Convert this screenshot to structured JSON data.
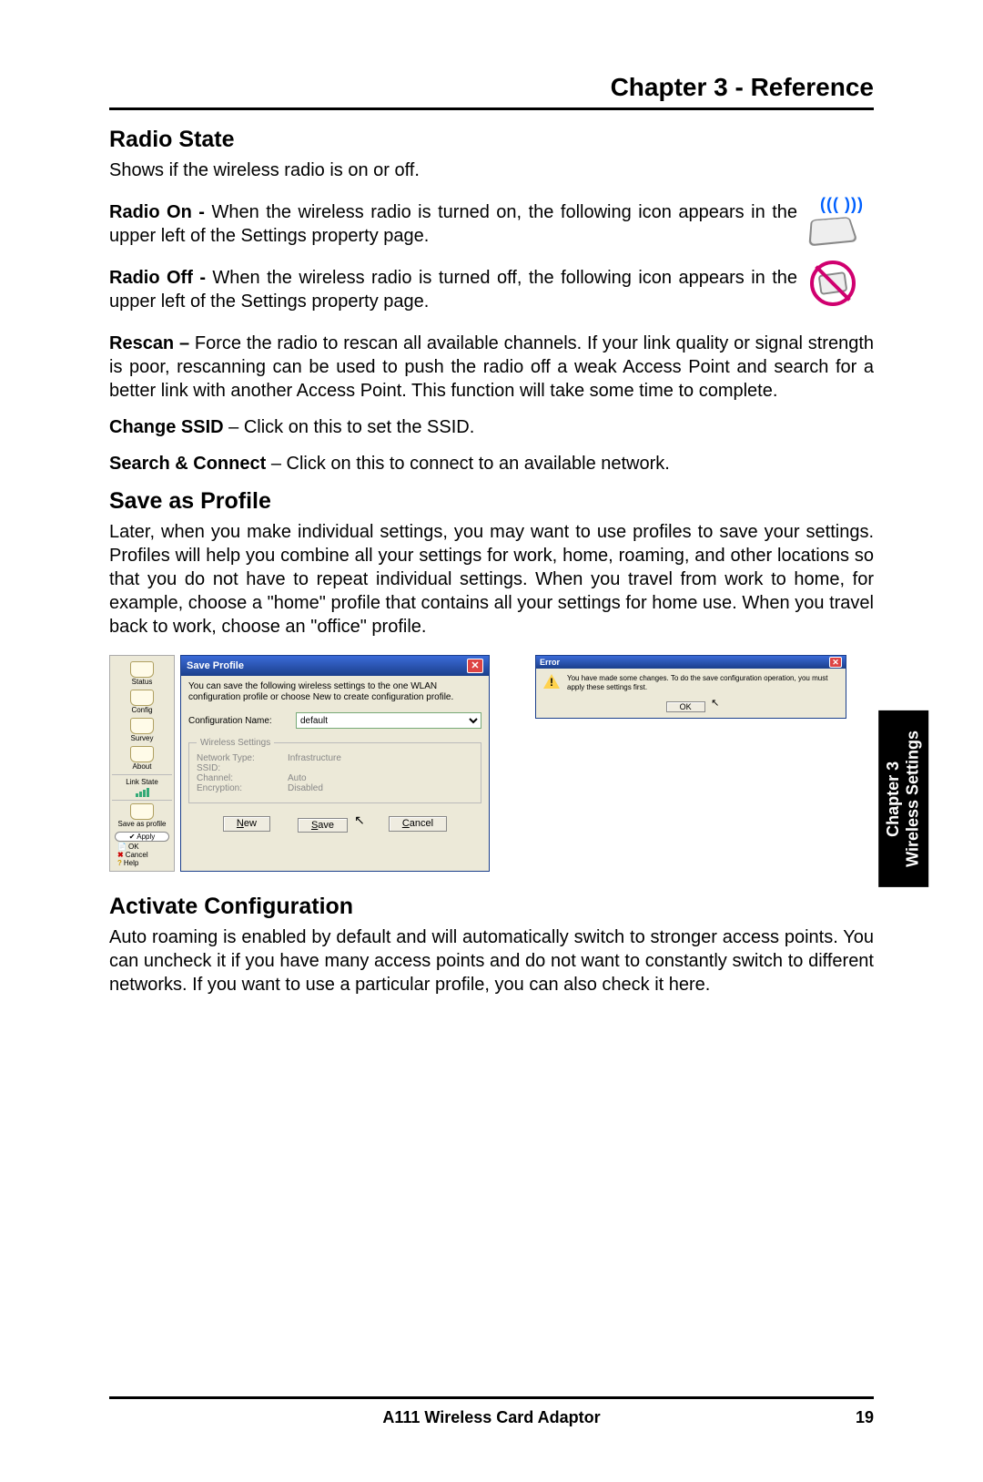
{
  "chapter_header": "Chapter 3 - Reference",
  "sections": {
    "radio_state": {
      "title": "Radio State",
      "intro": "Shows if the wireless radio is on or off.",
      "radio_on_label": "Radio On - ",
      "radio_on_text": "When the wireless radio is turned on, the following icon appears in the upper left of the Settings property page.",
      "radio_off_label": "Radio Off - ",
      "radio_off_text": "When the wireless radio is turned off, the following icon appears in the upper left of the Settings property page.",
      "rescan_label": "Rescan – ",
      "rescan_text": "Force the radio to rescan all available channels. If your link quality or signal strength is poor, rescanning can be used to push the radio off a weak Access Point and search for a better link with another Access Point. This function will take some time to complete.",
      "change_ssid_label": "Change SSID",
      "change_ssid_text": " – Click on this to set the SSID.",
      "search_connect_label": "Search & Connect",
      "search_connect_text": " – Click on this to connect to an available network."
    },
    "save_as_profile": {
      "title": "Save as Profile",
      "text": "Later, when you make individual settings, you may want to use profiles to save your settings. Profiles will help you combine all your settings for work, home, roaming, and other locations so that you do not have to repeat individual settings. When you travel from work to home, for example, choose a \"home\" profile that contains all your settings for home use. When you travel back to work, choose an \"office\" profile."
    },
    "activate_config": {
      "title": "Activate Configuration",
      "text": "Auto roaming is enabled by default and will automatically switch to stronger access points. You can uncheck it if you have many access points and do not want to constantly switch to different networks. If you want to use a particular profile, you can also check it here."
    }
  },
  "side_tab": {
    "line1": "Chapter 3",
    "line2": "Wireless  Settings"
  },
  "toolbar": {
    "items": [
      "Status",
      "Config",
      "Survey",
      "About"
    ],
    "link_state": "Link State",
    "save_profile": "Save as profile",
    "apply": "Apply",
    "ok": "OK",
    "cancel": "Cancel",
    "help": "Help"
  },
  "save_dialog": {
    "title": "Save Profile",
    "desc": "You can save the following wireless settings to the one WLAN configuration profile or choose New to create configuration profile.",
    "config_name_label": "Configuration Name:",
    "config_name_value": "default",
    "fieldset_legend": "Wireless Settings",
    "network_type_k": "Network Type:",
    "network_type_v": "Infrastructure",
    "ssid_k": "SSID:",
    "ssid_v": "",
    "channel_k": "Channel:",
    "channel_v": "Auto",
    "encryption_k": "Encryption:",
    "encryption_v": "Disabled",
    "btn_new": "New",
    "btn_save": "Save",
    "btn_cancel": "Cancel"
  },
  "error_dialog": {
    "title": "Error",
    "msg": "You have made some changes. To do the save configuration operation, you must apply these settings first.",
    "ok": "OK"
  },
  "footer": {
    "product": "A111 Wireless Card Adaptor",
    "page": "19"
  }
}
